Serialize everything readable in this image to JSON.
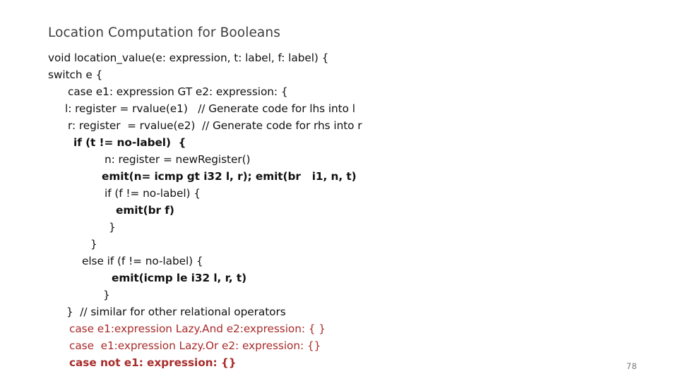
{
  "slide": {
    "title": "Location Computation for Booleans",
    "page_number": "78",
    "background_color": "#ffffff",
    "title_color": "#3c3c3c",
    "code_color": "#111111",
    "accent_red": "#a82b2b"
  },
  "code": {
    "lines": [
      {
        "text": "void location_value(e: expression, t: label, f: label) {",
        "indent": 0,
        "weight": "normal",
        "color": "default"
      },
      {
        "text": "switch e {",
        "indent": 0,
        "weight": "normal",
        "color": "default"
      },
      {
        "text": "case e1: expression GT e2: expression: {",
        "indent": 28,
        "weight": "normal",
        "color": "default"
      },
      {
        "text": "l: register = rvalue(e1)   // Generate code for lhs into l",
        "indent": 24,
        "weight": "normal",
        "color": "default"
      },
      {
        "text": "r: register  = rvalue(e2)  // Generate code for rhs into r",
        "indent": 28,
        "weight": "normal",
        "color": "default"
      },
      {
        "text": "if (t != no-label)  {",
        "indent": 36,
        "weight": "bold",
        "color": "default"
      },
      {
        "text": "n: register = newRegister()",
        "indent": 80,
        "weight": "normal",
        "color": "default"
      },
      {
        "text": "emit(n= icmp gt i32 l, r); emit(br   i1, n, t)",
        "indent": 76,
        "weight": "bold",
        "color": "default"
      },
      {
        "text": "if (f != no-label) {",
        "indent": 80,
        "weight": "normal",
        "color": "default"
      },
      {
        "text": "emit(br f)",
        "indent": 96,
        "weight": "bold",
        "color": "default"
      },
      {
        "text": "}",
        "indent": 86,
        "weight": "normal",
        "color": "default"
      },
      {
        "text": "}",
        "indent": 60,
        "weight": "normal",
        "color": "default"
      },
      {
        "text": "else if (f != no-label) {",
        "indent": 48,
        "weight": "normal",
        "color": "default"
      },
      {
        "text": "emit(icmp le i32 l, r, t)",
        "indent": 90,
        "weight": "bold",
        "color": "default"
      },
      {
        "text": "}",
        "indent": 78,
        "weight": "normal",
        "color": "default"
      },
      {
        "text": "}  // similar for other relational operators",
        "indent": 26,
        "weight": "normal",
        "color": "default"
      },
      {
        "text": "case e1:expression Lazy.And e2:expression: { }",
        "indent": 30,
        "weight": "normal",
        "color": "red"
      },
      {
        "text": "case  e1:expression Lazy.Or e2: expression: {}",
        "indent": 30,
        "weight": "normal",
        "color": "red"
      },
      {
        "text": "case not e1: expression: {}",
        "indent": 30,
        "weight": "bold",
        "color": "red"
      }
    ]
  }
}
